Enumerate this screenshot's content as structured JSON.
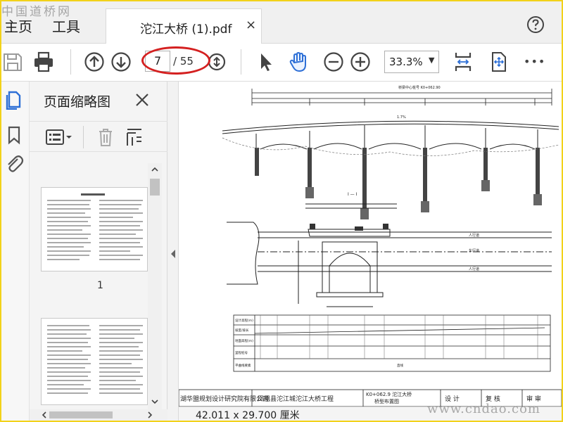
{
  "watermarks": {
    "top_left": "中国道桥网",
    "bottom_right": "www.cndao.com"
  },
  "nav": {
    "tabs": [
      {
        "label": "主页"
      },
      {
        "label": "工具"
      }
    ]
  },
  "document_tab": {
    "title": "沱江大桥 (1).pdf",
    "close_glyph": "×"
  },
  "toolbar": {
    "current_page": "7",
    "page_total": "/ 55",
    "zoom": "33.3%",
    "zoom_caret": "▼",
    "more_glyph": "•••"
  },
  "thumbnails_panel": {
    "title": "页面缩略图",
    "items": [
      {
        "label": "1"
      }
    ]
  },
  "document": {
    "page_size": "42.011 x 29.700 厘米",
    "title_block": {
      "institute": "湖华盟规划设计研究院有限公司",
      "project": "凤凰县沱江城沱江大桥工程",
      "drawing_no": "K0+062.9 沱江大桥",
      "drawing_name": "桥型布置图",
      "design": "设 计",
      "review": "复 核",
      "approve": "审 审"
    },
    "drawing": {
      "section_label": "I — I",
      "top_label": "桥梁中心桩号 K0+062.90",
      "slope": "1.7%",
      "deck_labels": [
        "人行道",
        "车行道",
        "人行道"
      ],
      "table_rows": [
        "设计高程(m)",
        "坡度/坡长",
        "地面高程(m)",
        "里程桩号",
        "平曲线要素"
      ],
      "table_note": "直线"
    }
  }
}
